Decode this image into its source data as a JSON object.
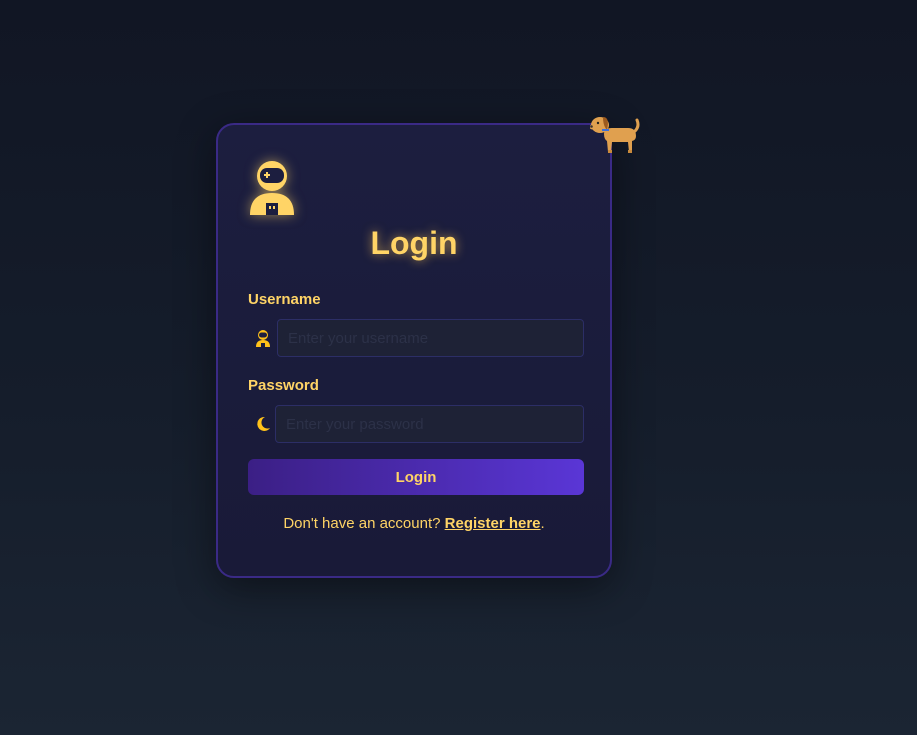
{
  "icons": {
    "avatar": "astronaut-icon",
    "username": "astronaut-icon",
    "password": "moon-icon",
    "mascot": "dog-icon"
  },
  "colors": {
    "accent": "#ffd466",
    "button_start": "#3b1f85",
    "button_end": "#5a36d6",
    "card_border": "#3a2a86"
  },
  "login": {
    "title": "Login",
    "username_label": "Username",
    "username_placeholder": "Enter your username",
    "username_value": "",
    "password_label": "Password",
    "password_placeholder": "Enter your password",
    "password_value": "",
    "button_label": "Login",
    "footer_text": "Don't have an account?",
    "register_link": "Register here",
    "footer_period": "."
  }
}
